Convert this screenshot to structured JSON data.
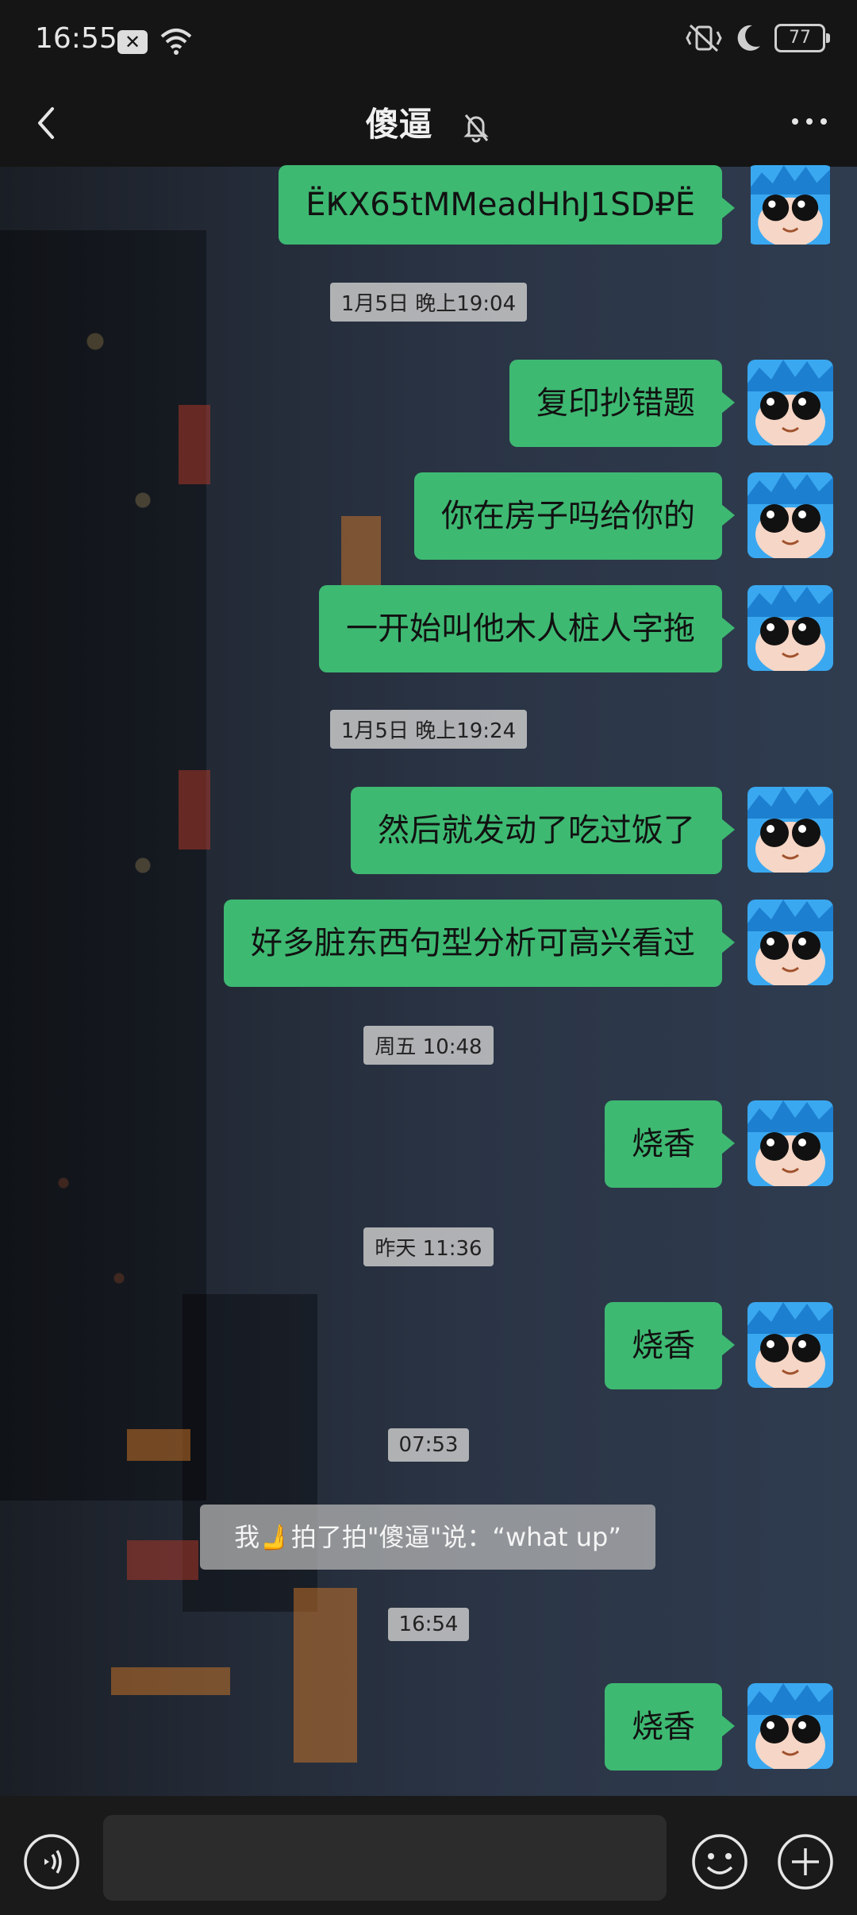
{
  "status": {
    "time": "16:55",
    "battery": "77"
  },
  "header": {
    "title": "傻逼"
  },
  "messages": [
    {
      "text": "ËҜX65tMMeadHhJ1SD₽Ë"
    },
    {
      "text": "复印抄错题"
    },
    {
      "text": "你在房子吗给你的"
    },
    {
      "text": "一开始叫他木人桩人字拖"
    },
    {
      "text": "然后就发动了吃过饭了"
    },
    {
      "text": "好多脏东西句型分析可高兴看过"
    },
    {
      "text": "烧香"
    },
    {
      "text": "烧香"
    },
    {
      "text": "烧香"
    }
  ],
  "timestamps": [
    "1月5日 晚上19:04",
    "1月5日 晚上19:24",
    "周五 10:48",
    "昨天 11:36",
    "07:53",
    "16:54"
  ],
  "pat_notice": "我🫸拍了拍\"傻逼\"说：“what up”",
  "colors": {
    "bubble": "#3eb972",
    "background": "#151515"
  },
  "icons": [
    "back-arrow-icon",
    "mute-bell-icon",
    "more-icon",
    "voice-icon",
    "emoji-icon",
    "plus-icon",
    "avatar-icon"
  ]
}
